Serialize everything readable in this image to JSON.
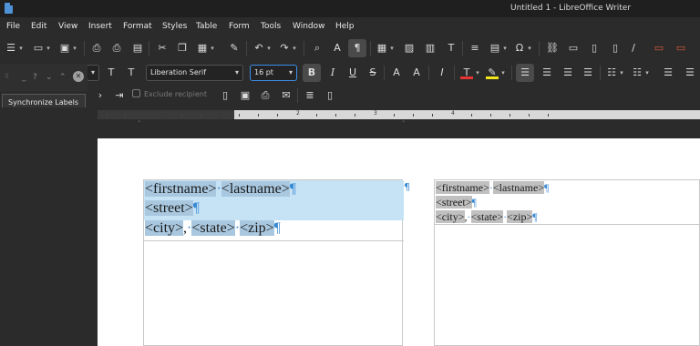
{
  "window": {
    "title": "Untitled 1 - LibreOffice Writer"
  },
  "menu": [
    "File",
    "Edit",
    "View",
    "Insert",
    "Format",
    "Styles",
    "Table",
    "Form",
    "Tools",
    "Window",
    "Help"
  ],
  "formatting": {
    "font_name": "Liberation Serif",
    "font_size": "16 pt"
  },
  "floating_toolbar": {
    "sync_button_label": "Synchronize Labels",
    "controls": [
      "_",
      "?",
      "⌄",
      "⌃"
    ]
  },
  "mail_merge": {
    "exclude_label": "Exclude recipient"
  },
  "ruler": {
    "numbers": [
      "1",
      "1",
      "2",
      "3",
      "4"
    ]
  },
  "document": {
    "paragraph_mark": "¶",
    "space_mark": "·",
    "label_fields": {
      "firstname": "<firstname>",
      "lastname": "<lastname>",
      "street": "<street>",
      "city": "<city>",
      "comma": ",",
      "state": "<state>",
      "zip": "<zip>"
    }
  },
  "icons": {
    "tb1": [
      "styles-icon",
      "open-icon",
      "save-icon",
      "export-pdf-icon",
      "print-icon",
      "print-preview-icon",
      "cut-icon",
      "copy-icon",
      "paste-icon",
      "clone-formatting-icon",
      "undo-icon",
      "redo-icon",
      "find-replace-icon",
      "spelling-icon",
      "formatting-marks-icon",
      "table-icon",
      "image-icon",
      "chart-icon",
      "textbox-icon",
      "page-break-icon",
      "field-icon",
      "special-character-icon",
      "hyperlink-icon",
      "footnote-icon",
      "comment-icon",
      "track-changes-icon",
      "line-icon",
      "shapes-icon",
      "header-icon",
      "footer-icon"
    ]
  },
  "colors": {
    "accent": "#3d8ee6",
    "font_color": "#e83333",
    "highlight": "#f2e51a",
    "selection": "#c6e2f5"
  }
}
